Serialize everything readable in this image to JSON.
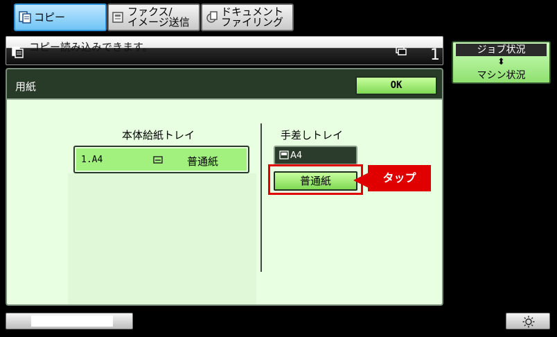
{
  "tabs": {
    "copy": "コピー",
    "fax_line1": "ファクス/",
    "fax_line2": "イメージ送信",
    "doc_line1": "ドキュメント",
    "doc_line2": "ファイリング"
  },
  "status": {
    "message": "コピー読み込みできます。",
    "count": "1"
  },
  "job_button": {
    "top": "ジョブ状況",
    "arrow": "⬍",
    "bottom": "マシン状況"
  },
  "panel": {
    "title": "用紙",
    "ok": "OK",
    "main_tray": {
      "label": "本体給紙トレイ",
      "size": "1.A4",
      "type": "普通紙"
    },
    "bypass_tray": {
      "label": "手差しトレイ",
      "size": "A4",
      "type": "普通紙"
    }
  },
  "callout": {
    "text": "タップ",
    "color": "#e00000"
  },
  "bottom": {
    "brightness_icon": "sun-icon"
  }
}
